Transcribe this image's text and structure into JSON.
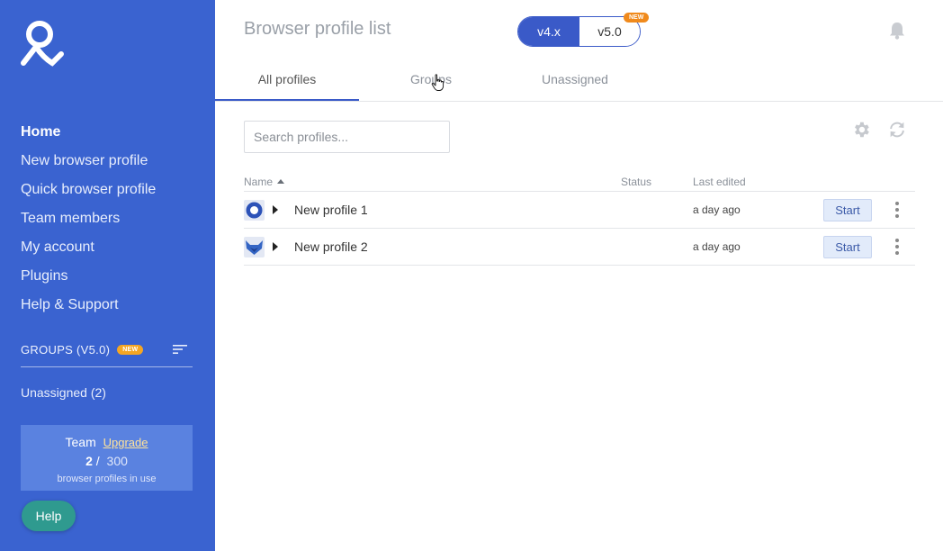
{
  "sidebar": {
    "nav": [
      {
        "label": "Home",
        "active": true
      },
      {
        "label": "New browser profile"
      },
      {
        "label": "Quick browser profile"
      },
      {
        "label": "Team members"
      },
      {
        "label": "My account"
      },
      {
        "label": "Plugins"
      },
      {
        "label": "Help & Support"
      }
    ],
    "groups": {
      "title": "GROUPS (V5.0)",
      "badge": "NEW"
    },
    "unassigned": "Unassigned (2)",
    "plan": {
      "name": "Team",
      "upgrade": "Upgrade",
      "used": "2",
      "separator": "/",
      "total": "300",
      "caption": "browser profiles in use"
    },
    "help": "Help"
  },
  "header": {
    "title": "Browser profile list",
    "version_left": "v4.x",
    "version_right": "v5.0",
    "version_badge": "NEW"
  },
  "tabs": [
    {
      "label": "All profiles",
      "active": true
    },
    {
      "label": "Groups"
    },
    {
      "label": "Unassigned"
    }
  ],
  "search": {
    "placeholder": "Search profiles..."
  },
  "table": {
    "columns": {
      "name": "Name",
      "status": "Status",
      "edited": "Last edited"
    },
    "rows": [
      {
        "name": "New profile 1",
        "status": "",
        "edited": "a day ago",
        "action": "Start",
        "icon": "orbita-browser-icon"
      },
      {
        "name": "New profile 2",
        "status": "",
        "edited": "a day ago",
        "action": "Start",
        "icon": "mimic-fox-icon"
      }
    ]
  },
  "colors": {
    "sidebar": "#3a63d0",
    "accent": "#3a5ac8",
    "badge": "#f08a1c",
    "help": "#2f9a8f"
  }
}
